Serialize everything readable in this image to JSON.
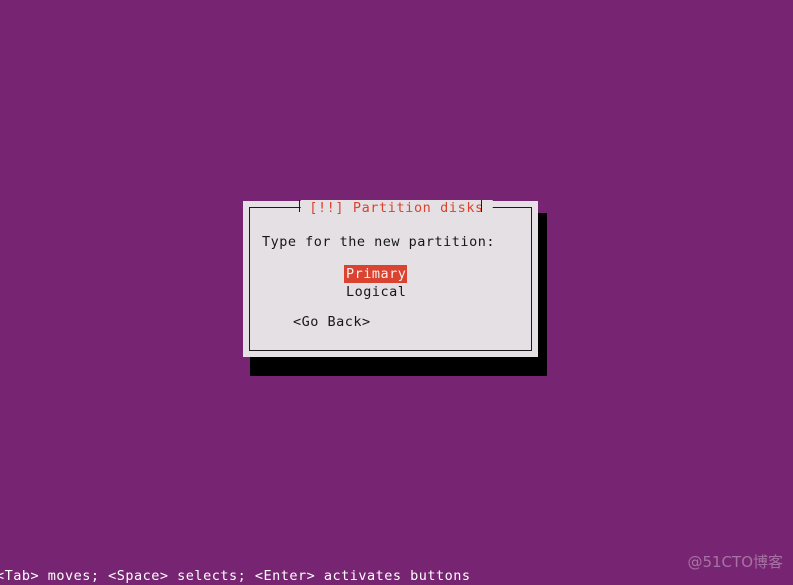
{
  "screen": {
    "background_color": "#772572",
    "name": "debian-installer-console"
  },
  "dialog": {
    "title": "[!!] Partition disks",
    "title_color": "#d9432f",
    "background_color": "#e4e0e4",
    "border_color": "#1b1b1b",
    "shadow_color": "#000000",
    "prompt": "Type for the new partition:",
    "choices": [
      {
        "label": "Primary",
        "selected": true
      },
      {
        "label": "Logical",
        "selected": false
      }
    ],
    "buttons": [
      {
        "label": "<Go Back>"
      }
    ],
    "highlight_background": "#d9432f",
    "highlight_text_color": "#f4f0f2"
  },
  "status_bar": {
    "text": "<Tab> moves; <Space> selects; <Enter> activates buttons",
    "text_color": "#ffffff"
  },
  "watermark": {
    "text": "@51CTO博客"
  }
}
